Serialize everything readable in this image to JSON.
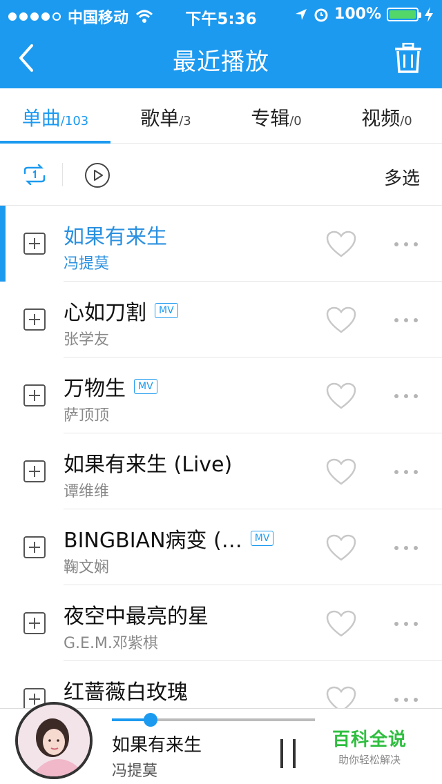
{
  "status": {
    "carrier": "中国移动",
    "time": "下午5:36",
    "battery": "100%"
  },
  "nav": {
    "title": "最近播放"
  },
  "tabs": [
    {
      "label": "单曲",
      "count": "/103"
    },
    {
      "label": "歌单",
      "count": "/3"
    },
    {
      "label": "专辑",
      "count": "/0"
    },
    {
      "label": "视频",
      "count": "/0"
    }
  ],
  "toolbar": {
    "loop_icon": "repeat-one-icon",
    "play_icon": "play-circle-icon",
    "multiselect": "多选"
  },
  "songs": [
    {
      "title": "如果有来生",
      "artist": "冯提莫",
      "mv": "",
      "playing": true
    },
    {
      "title": "心如刀割",
      "artist": "张学友",
      "mv": "MV"
    },
    {
      "title": "万物生",
      "artist": "萨顶顶",
      "mv": "MV"
    },
    {
      "title": "如果有来生 (Live)",
      "artist": "谭维维",
      "mv": ""
    },
    {
      "title": "BINGBIAN病变 (…",
      "artist": "鞠文娴",
      "mv": "MV"
    },
    {
      "title": "夜空中最亮的星",
      "artist": "G.E.M.邓紫棋",
      "mv": ""
    },
    {
      "title": "红蔷薇白玫瑰",
      "artist": "",
      "mv": ""
    }
  ],
  "player": {
    "title": "如果有来生",
    "artist": "冯提莫",
    "progress": 0.19
  },
  "watermark": {
    "line1": "百科全说",
    "line2": "助你轻松解决"
  },
  "colors": {
    "accent": "#1c9af0",
    "watermark": "#2fbe3f"
  }
}
